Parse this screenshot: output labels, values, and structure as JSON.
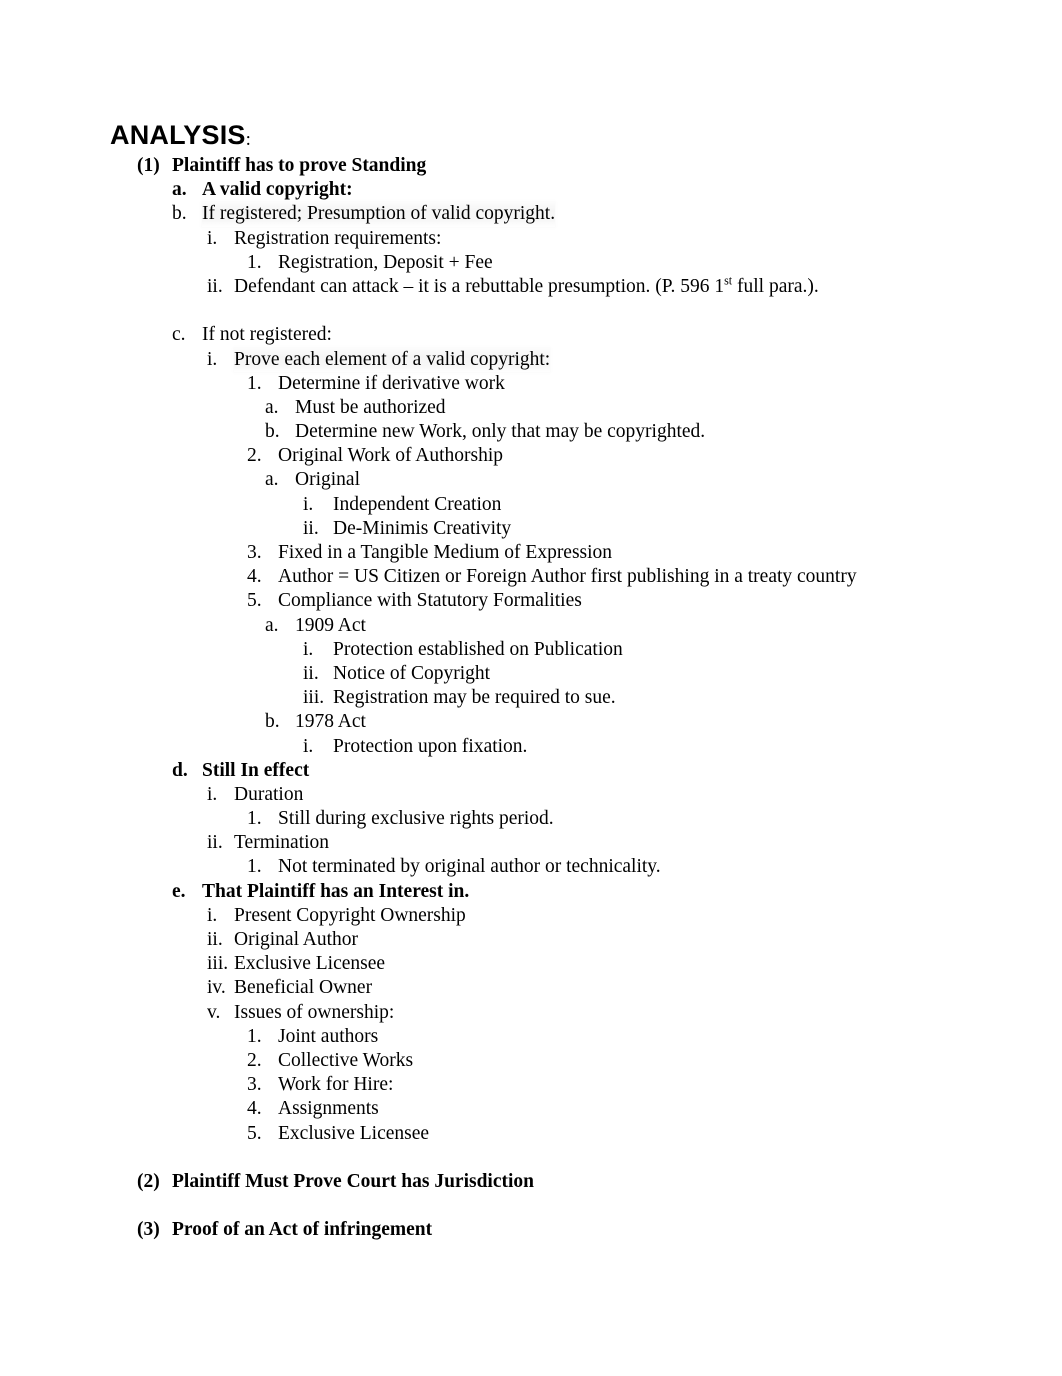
{
  "document": {
    "heading": {
      "title": "ANALYSIS",
      "colon": ":"
    },
    "outline": [
      {
        "id": "item-1",
        "marker": "(1)",
        "text": "Plaintiff has to prove Standing",
        "level": 1,
        "bold": true,
        "shade": false
      },
      {
        "id": "item-1a",
        "marker": "a.",
        "text": "A valid copyright:",
        "level": 2,
        "bold": true,
        "shade": false
      },
      {
        "id": "item-1b",
        "marker": "b.",
        "text": "If registered; Presumption of valid copyright.",
        "level": 2,
        "bold": false,
        "shade": true
      },
      {
        "id": "item-1b-i",
        "marker": "i.",
        "text": "Registration requirements:",
        "level": 3,
        "bold": false,
        "shade": false
      },
      {
        "id": "item-1b-i-1",
        "marker": "1.",
        "text": "Registration, Deposit + Fee",
        "level": 4,
        "bold": false,
        "shade": false
      },
      {
        "id": "item-1b-ii",
        "marker": "ii.",
        "text": "Defendant can attack – it is a rebuttable presumption. (P. 596 1",
        "level": 3,
        "bold": false,
        "shade": false,
        "sup": "st",
        "text_after": " full para.)."
      },
      {
        "id": "spacer-1",
        "type": "spacer"
      },
      {
        "id": "item-1c",
        "marker": "c.",
        "text": "If not registered:",
        "level": 2,
        "bold": false,
        "shade": false
      },
      {
        "id": "item-1c-i",
        "marker": "i.",
        "text": "Prove each element of a valid copyright:",
        "level": 3,
        "bold": false,
        "shade": true
      },
      {
        "id": "item-1c-i-1",
        "marker": "1.",
        "text": "Determine if derivative work",
        "level": 4,
        "bold": false,
        "shade": false
      },
      {
        "id": "item-1c-i-1a",
        "marker": "a.",
        "text": "Must be authorized",
        "level": 5,
        "bold": false,
        "shade": false
      },
      {
        "id": "item-1c-i-1b",
        "marker": "b.",
        "text": "Determine new Work, only that may be copyrighted.",
        "level": 5,
        "bold": false,
        "shade": false
      },
      {
        "id": "item-1c-i-2",
        "marker": "2.",
        "text": "Original Work of Authorship",
        "level": 4,
        "bold": false,
        "shade": false
      },
      {
        "id": "item-1c-i-2a",
        "marker": "a.",
        "text": "Original",
        "level": 5,
        "bold": false,
        "shade": false
      },
      {
        "id": "item-2a-i",
        "marker": "i.",
        "text": "Independent Creation",
        "level": 6,
        "bold": false,
        "shade": false
      },
      {
        "id": "item-2a-ii",
        "marker": "ii.",
        "text": "De-Minimis Creativity",
        "level": 6,
        "bold": false,
        "shade": false
      },
      {
        "id": "item-1c-i-3",
        "marker": "3.",
        "text": "Fixed in a Tangible Medium of Expression",
        "level": 4,
        "bold": false,
        "shade": false
      },
      {
        "id": "item-1c-i-4",
        "marker": "4.",
        "text": "Author = US Citizen or Foreign Author first publishing in a treaty country",
        "level": 4,
        "bold": false,
        "shade": false
      },
      {
        "id": "item-1c-i-5",
        "marker": "5.",
        "text": "Compliance with Statutory Formalities",
        "level": 4,
        "bold": false,
        "shade": false
      },
      {
        "id": "item-5a",
        "marker": "a.",
        "text": "1909 Act",
        "level": 5,
        "bold": false,
        "shade": false
      },
      {
        "id": "item-5a-i",
        "marker": "i.",
        "text": "Protection established on Publication",
        "level": 6,
        "bold": false,
        "shade": false
      },
      {
        "id": "item-5a-ii",
        "marker": "ii.",
        "text": "Notice of Copyright",
        "level": 6,
        "bold": false,
        "shade": false
      },
      {
        "id": "item-5a-iii",
        "marker": "iii.",
        "text": "Registration may be required to sue.",
        "level": 6,
        "bold": false,
        "shade": false
      },
      {
        "id": "item-5b",
        "marker": "b.",
        "text": "1978 Act",
        "level": 5,
        "bold": false,
        "shade": false
      },
      {
        "id": "item-5b-i",
        "marker": "i.",
        "text": "Protection upon fixation.",
        "level": 6,
        "bold": false,
        "shade": false
      },
      {
        "id": "item-1d",
        "marker": "d.",
        "text": "Still In effect",
        "level": 2,
        "bold": true,
        "shade": false
      },
      {
        "id": "item-1d-i",
        "marker": "i.",
        "text": "Duration",
        "level": 3,
        "bold": false,
        "shade": false
      },
      {
        "id": "item-1d-i-1",
        "marker": "1.",
        "text": "Still during exclusive rights period.",
        "level": 4,
        "bold": false,
        "shade": false
      },
      {
        "id": "item-1d-ii",
        "marker": "ii.",
        "text": "Termination",
        "level": 3,
        "bold": false,
        "shade": false
      },
      {
        "id": "item-1d-ii-1",
        "marker": "1.",
        "text": "Not terminated by original author or technicality.",
        "level": 4,
        "bold": false,
        "shade": false
      },
      {
        "id": "item-1e",
        "marker": "e.",
        "text": "That Plaintiff has an Interest in.",
        "level": 2,
        "bold": true,
        "shade": false
      },
      {
        "id": "item-1e-i",
        "marker": "i.",
        "text": "Present Copyright Ownership",
        "level": 3,
        "bold": false,
        "shade": false
      },
      {
        "id": "item-1e-ii",
        "marker": "ii.",
        "text": "Original Author",
        "level": 3,
        "bold": false,
        "shade": false
      },
      {
        "id": "item-1e-iii",
        "marker": "iii.",
        "text": "Exclusive Licensee",
        "level": 3,
        "bold": false,
        "shade": false
      },
      {
        "id": "item-1e-iv",
        "marker": "iv.",
        "text": "Beneficial Owner",
        "level": 3,
        "bold": false,
        "shade": false
      },
      {
        "id": "item-1e-v",
        "marker": "v.",
        "text": "Issues of ownership:",
        "level": 3,
        "bold": false,
        "shade": false
      },
      {
        "id": "item-1e-v-1",
        "marker": "1.",
        "text": "Joint authors",
        "level": 4,
        "bold": false,
        "shade": false
      },
      {
        "id": "item-1e-v-2",
        "marker": "2.",
        "text": "Collective Works",
        "level": 4,
        "bold": false,
        "shade": false
      },
      {
        "id": "item-1e-v-3",
        "marker": "3.",
        "text": "Work for Hire:",
        "level": 4,
        "bold": false,
        "shade": false
      },
      {
        "id": "item-1e-v-4",
        "marker": "4.",
        "text": "Assignments",
        "level": 4,
        "bold": false,
        "shade": false
      },
      {
        "id": "item-1e-v-5",
        "marker": "5.",
        "text": "Exclusive Licensee",
        "level": 4,
        "bold": false,
        "shade": false
      },
      {
        "id": "spacer-2",
        "type": "spacer"
      },
      {
        "id": "item-2",
        "marker": "(2)",
        "text": "Plaintiff Must Prove Court has Jurisdiction",
        "level": 1,
        "bold": true,
        "shade": false
      },
      {
        "id": "spacer-3",
        "type": "spacer"
      },
      {
        "id": "item-3",
        "marker": "(3)",
        "text": "Proof of an Act of infringement",
        "level": 1,
        "bold": true,
        "shade": false
      }
    ]
  }
}
